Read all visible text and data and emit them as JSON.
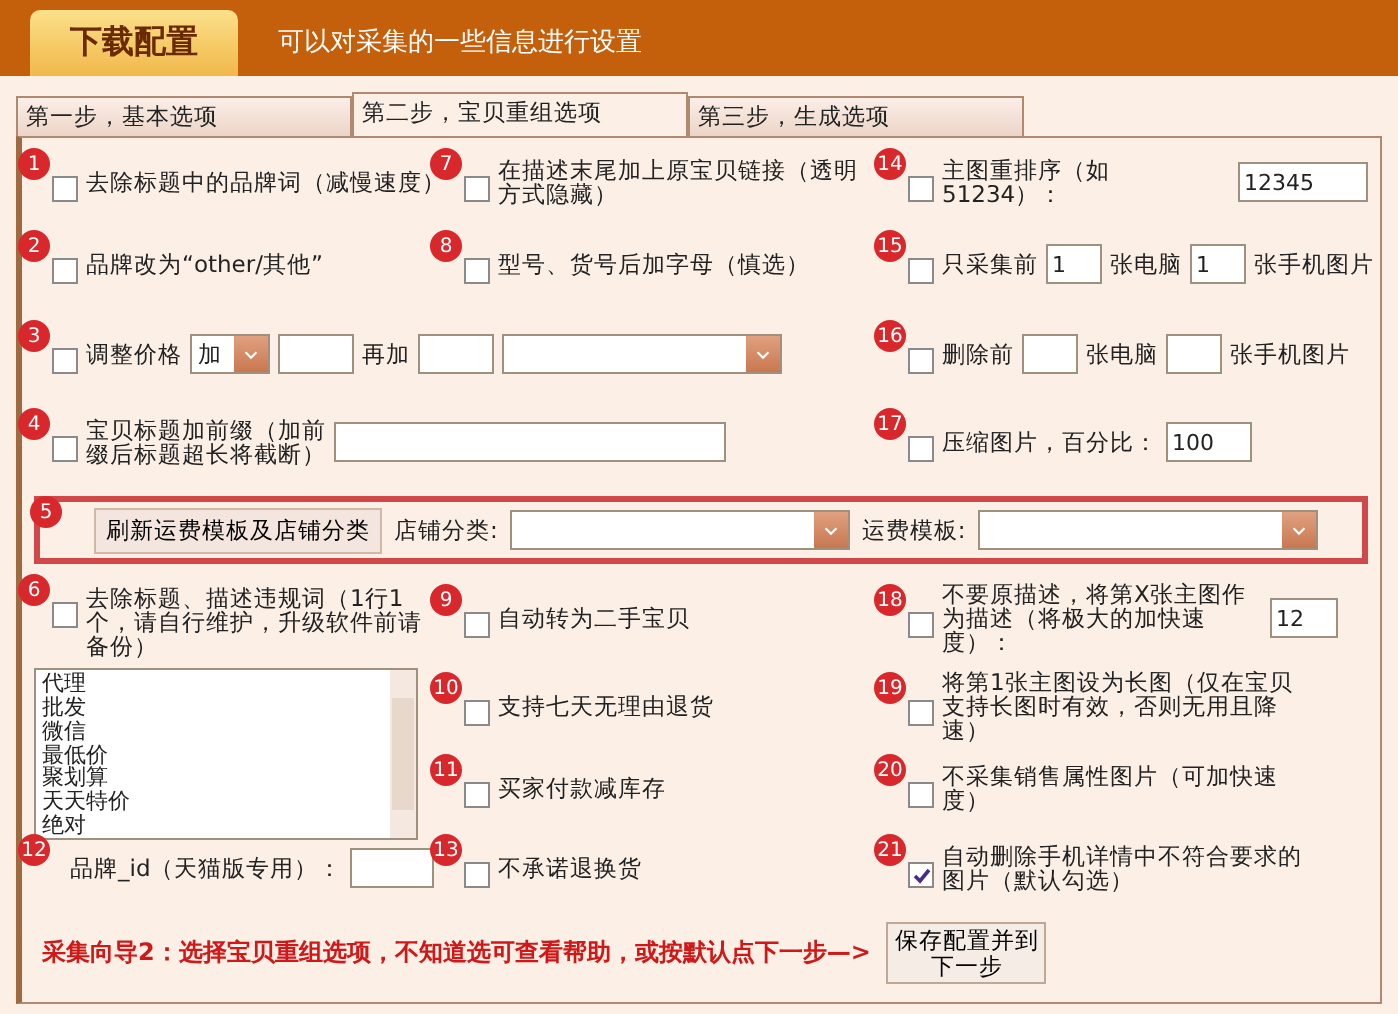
{
  "header": {
    "tab": "下载配置",
    "subtitle": "可以对采集的一些信息进行设置"
  },
  "tabs": [
    {
      "label": "第一步，基本选项",
      "selected": false
    },
    {
      "label": "第二步，宝贝重组选项",
      "selected": true
    },
    {
      "label": "第三步，生成选项",
      "selected": false
    }
  ],
  "items": [
    {
      "kind": "checkbox",
      "badge": "1",
      "label": "去除标题中的品牌词（减慢速度）",
      "checked": false
    },
    {
      "kind": "checkbox",
      "badge": "7",
      "label": "在描述末尾加上原宝贝链接（透明方式隐藏）",
      "checked": false
    },
    {
      "kind": "checkbox_input",
      "badge": "14",
      "label": "主图重排序（如51234）：",
      "value": "12345",
      "checked": false
    },
    {
      "kind": "checkbox",
      "badge": "2",
      "label": "品牌改为“other/其他”",
      "checked": false
    },
    {
      "kind": "checkbox",
      "badge": "8",
      "label": "型号、货号后加字母（慎选）",
      "checked": false
    },
    {
      "kind": "count",
      "badge": "15",
      "label": "只采集前",
      "pc_value": "1",
      "pc_unit": "张电脑",
      "phone_value": "1",
      "phone_unit": "张手机图片",
      "checked": false
    },
    {
      "kind": "price",
      "badge": "3",
      "label": "调整价格",
      "operator": "加",
      "second_label": "再加",
      "checked": false
    },
    {
      "kind": "count",
      "badge": "16",
      "label": "删除前",
      "pc_unit": "张电脑",
      "phone_unit": "张手机图片",
      "checked": false
    },
    {
      "kind": "prefix",
      "badge": "4",
      "label": "宝贝标题加前缀（加前缀后标题超长将截断）",
      "checked": false
    },
    {
      "kind": "checkbox_input",
      "badge": "17",
      "label": "压缩图片，百分比：",
      "value": "100",
      "checked": false
    },
    {
      "kind": "freight",
      "badge": "5",
      "button": "刷新运费模板及店铺分类",
      "category_label": "店铺分类:",
      "template_label": "运费模板:"
    },
    {
      "kind": "keywords",
      "badge": "6",
      "label": "去除标题、描述违规词（1行1个，请自行维护，升级软件前请备份）",
      "checked": false,
      "lines": [
        "代理",
        "批发",
        "微信",
        "最低价",
        "聚划算",
        "天天特价",
        "绝对"
      ]
    },
    {
      "kind": "checkbox",
      "badge": "9",
      "label": "自动转为二手宝贝",
      "checked": false
    },
    {
      "kind": "checkbox_input",
      "badge": "18",
      "label": "不要原描述，将第X张主图作为描述（将极大的加快速度）：",
      "value": "12",
      "checked": false
    },
    {
      "kind": "checkbox",
      "badge": "10",
      "label": "支持七天无理由退货",
      "checked": false
    },
    {
      "kind": "checkbox",
      "badge": "19",
      "label": "将第1张主图设为长图（仅在宝贝支持长图时有效，否则无用且降速）",
      "checked": false
    },
    {
      "kind": "checkbox",
      "badge": "11",
      "label": "买家付款减库存",
      "checked": false
    },
    {
      "kind": "checkbox",
      "badge": "20",
      "label": "不采集销售属性图片（可加快速度）",
      "checked": false
    },
    {
      "kind": "field",
      "badge": "12",
      "label": "品牌_id（天猫版专用）："
    },
    {
      "kind": "checkbox",
      "badge": "13",
      "label": "不承诺退换货",
      "checked": false
    },
    {
      "kind": "checkbox",
      "badge": "21",
      "label": "自动删除手机详情中不符合要求的图片（默认勾选）",
      "checked": true
    }
  ],
  "footer": {
    "guide": "采集向导2：选择宝贝重组选项，不知道选可查看帮助，或按默认点下一步—>",
    "save_button": "保存配置并到下一步"
  }
}
